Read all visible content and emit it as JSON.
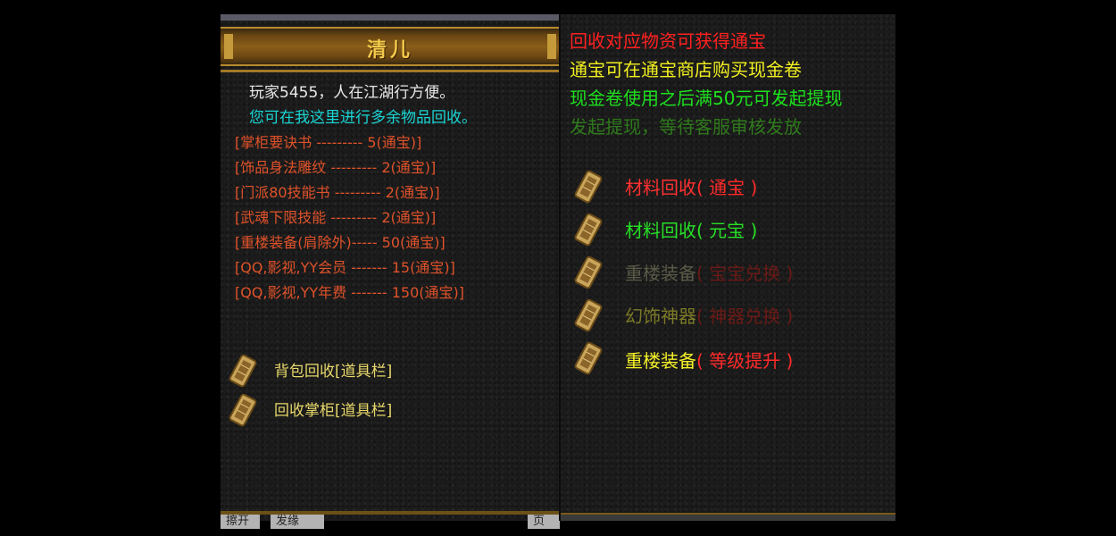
{
  "left": {
    "title": "清儿",
    "greeting": "玩家5455，人在江湖行方便。",
    "subtitle": "您可在我这里进行多余物品回收。",
    "items": [
      "[掌柜要诀书     --------- 5(通宝)]",
      "[饰品身法雕纹 --------- 2(通宝)]",
      "[门派80技能书 --------- 2(通宝)]",
      "[武魂下限技能 --------- 2(通宝)]",
      "[重楼装备(肩除外)----- 50(通宝)]",
      "[QQ,影视,YY会员 ------- 15(通宝)]",
      "[QQ,影视,YY年费 ------- 150(通宝)]"
    ],
    "links": [
      "背包回收[道具栏]",
      "回收掌柜[道具栏]"
    ],
    "bottom_tabs": [
      "擦开",
      "发缘",
      "页"
    ]
  },
  "right": {
    "lines": [
      "回收对应物资可获得通宝",
      "通宝可在通宝商店购买现金卷",
      "现金卷使用之后满50元可发起提现",
      "发起提现，等待客服审核发放"
    ],
    "options": [
      {
        "label": "材料回收",
        "paren": "( 通宝 )"
      },
      {
        "label": "材料回收",
        "paren": "( 元宝 )"
      },
      {
        "label": "重楼装备",
        "paren": "( 宝宝兑换 )"
      },
      {
        "label": "幻饰神器",
        "paren": "( 神器兑换 )"
      },
      {
        "label": "重楼装备",
        "paren": "( 等级提升 )"
      }
    ]
  },
  "colors": {
    "item_text": "#e0522a",
    "link_text": "#e8d86a",
    "title_gold": "#f2c94a"
  },
  "icons": [
    "scroll-token-icon"
  ]
}
